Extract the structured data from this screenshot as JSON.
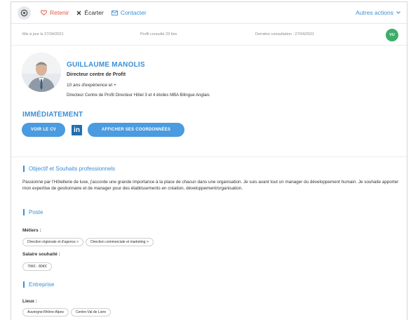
{
  "toolbar": {
    "retenir": "Retenir",
    "ecarter": "Écarter",
    "contacter": "Contacter",
    "autres": "Autres actions"
  },
  "meta": {
    "updated": "Mis à jour le 27/04/2021",
    "views": "Profil consulté 23 fois",
    "last": "Dernière consultation : 27/04/2021",
    "badge": "VU"
  },
  "profile": {
    "name": "GUILLAUME MANOLIS",
    "title": "Directeur centre de Profit",
    "experience": "10 ans d'expérience et +",
    "headline": "Directeur Centre de Profit Directeur Hôtel 3 et 4 étoiles MBA Bilingue Anglais",
    "availability": "IMMÉDIATEMENT",
    "btn_cv": "VOIR LE CV",
    "linkedin": "in",
    "btn_coord": "AFFICHER SES COORDONNÉES"
  },
  "objectif": {
    "title": "Objectif et Souhaits professionnels",
    "text": "Passionné par l'Hôtellerie de luxe, j'accorde une grande importance à la place de chacun dans une organisation. Je suis avant tout un manager du développement humain. Je souhaite apporter mon expertise de gestionnaire et de manager pour des établissements en création, développement/organisation."
  },
  "poste": {
    "title": "Poste",
    "metiers_label": "Métiers :",
    "metiers": [
      "Direction régionale et d'agence >",
      "Direction commerciale et marketing >"
    ],
    "salaire_label": "Salaire souhaité :",
    "salaire": [
      "70K€ - 80K€"
    ]
  },
  "entreprise": {
    "title": "Entreprise",
    "lieux_label": "Lieux :",
    "lieux": [
      "Auvergne-Rhône-Alpes",
      "Centre-Val de Loire"
    ]
  },
  "colors": {
    "accent": "#3b8fd6",
    "retenir": "#e05a4a",
    "badge": "#3cae6a",
    "linkedin": "#1f6fb0"
  }
}
